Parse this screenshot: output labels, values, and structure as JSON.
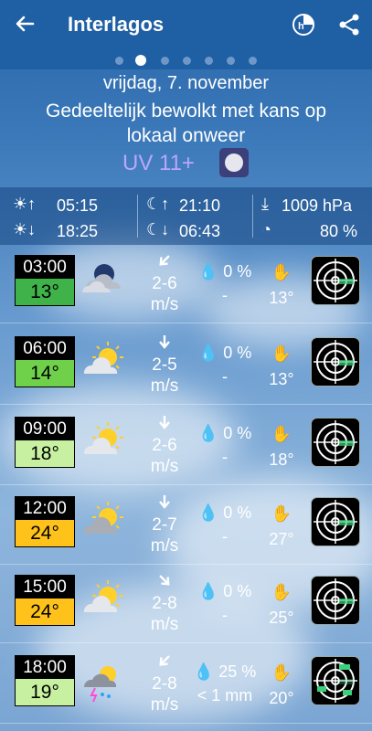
{
  "header": {
    "title": "Interlagos"
  },
  "summary": {
    "date": "vrijdag, 7. november",
    "description": "Gedeeltelijk bewolkt met kans op lokaal onweer",
    "uv": "UV 11+"
  },
  "sun_moon": {
    "sunrise": "05:15",
    "sunset": "18:25",
    "moonrise": "21:10",
    "moonset": "06:43",
    "pressure": "1009 hPa",
    "humidity": "80 %"
  },
  "hours": [
    {
      "time": "03:00",
      "temp": "13°",
      "temp_color": "#3fb34a",
      "wind": "2-6",
      "unit": "m/s",
      "precip": "0 %",
      "amount": "-",
      "feel": "13°",
      "icon": "night-partly-cloudy-icon",
      "arrow_angle": -45
    },
    {
      "time": "06:00",
      "temp": "14°",
      "temp_color": "#6fd04a",
      "wind": "2-5",
      "unit": "m/s",
      "precip": "0 %",
      "amount": "-",
      "feel": "13°",
      "icon": "sun-cloud-icon",
      "arrow_angle": -90
    },
    {
      "time": "09:00",
      "temp": "18°",
      "temp_color": "#c7f0a0",
      "wind": "2-6",
      "unit": "m/s",
      "precip": "0 %",
      "amount": "-",
      "feel": "18°",
      "icon": "sun-cloud-icon",
      "arrow_angle": -90
    },
    {
      "time": "12:00",
      "temp": "24°",
      "temp_color": "#ffc21a",
      "wind": "2-7",
      "unit": "m/s",
      "precip": "0 %",
      "amount": "-",
      "feel": "27°",
      "icon": "sun-fog-cloud-icon",
      "arrow_angle": -90
    },
    {
      "time": "15:00",
      "temp": "24°",
      "temp_color": "#ffc21a",
      "wind": "2-8",
      "unit": "m/s",
      "precip": "0 %",
      "amount": "-",
      "feel": "25°",
      "icon": "sun-cloud-icon",
      "arrow_angle": -135
    },
    {
      "time": "18:00",
      "temp": "19°",
      "temp_color": "#c7f0a0",
      "wind": "2-8",
      "unit": "m/s",
      "precip": "25 %",
      "amount": "< 1 mm",
      "feel": "20°",
      "icon": "thunderstorm-icon",
      "arrow_angle": -45
    }
  ]
}
